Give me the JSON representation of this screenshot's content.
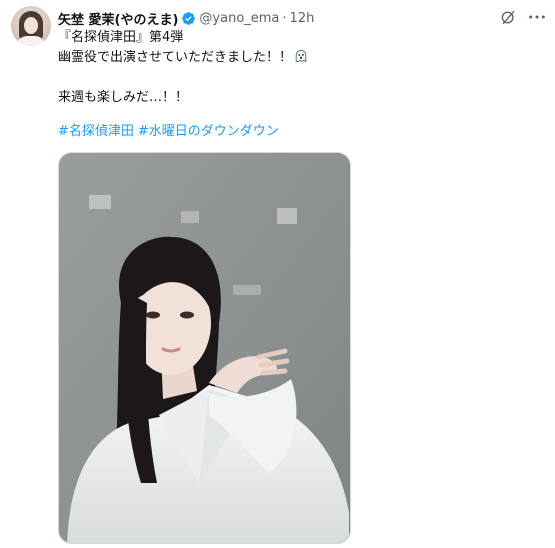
{
  "post": {
    "display_name": "矢埜 愛茉(やのえま)",
    "handle": "@yano_ema",
    "separator": "·",
    "time": "12h",
    "text_line_1": "『名探偵津田』第4弾",
    "text_line_2": "幽霊役で出演させていただきました！！",
    "text_line_3": "来週も楽しみだ…！！",
    "hashtags": [
      "#名探偵津田",
      "#水曜日のダウンダウン"
    ]
  },
  "icons": {
    "verified": "verified-badge-icon",
    "grok": "grok-icon",
    "more": "more-options-icon",
    "ghost": "ghost-emoji-icon"
  },
  "colors": {
    "accent": "#1d9bf0",
    "text": "#0f1419",
    "muted": "#536471",
    "photo_wall": "#8f9292"
  }
}
